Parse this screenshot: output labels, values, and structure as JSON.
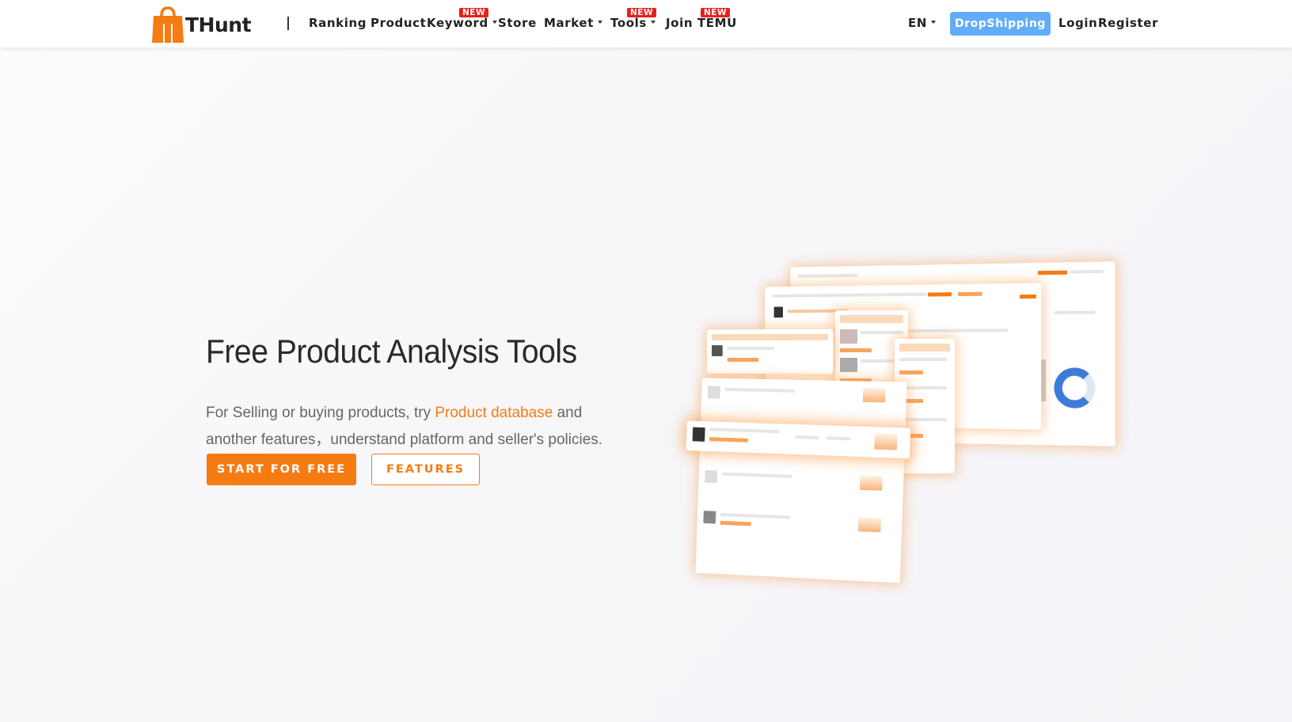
{
  "brand": {
    "name": "THunt",
    "accent": "#f57b13",
    "badge_color": "#e8201c",
    "dropship_color": "#62adf7"
  },
  "nav": {
    "ranking": "Ranking",
    "product": "Product",
    "keyword": "Keyword",
    "store": "Store",
    "market": "Market",
    "tools": "Tools",
    "join_temu": "Join TEMU",
    "new_badge": "NEW"
  },
  "header_right": {
    "language": "EN",
    "dropshipping": "DropShipping",
    "login": "Login",
    "register": "Register"
  },
  "hero": {
    "title": "Free Product Analysis Tools",
    "desc_before": "For Selling or buying products, try ",
    "desc_link": "Product database",
    "desc_after": " and another features，understand platform and seller's policies.",
    "start_button": "START FOR FREE",
    "features_button": "FEATURES"
  }
}
